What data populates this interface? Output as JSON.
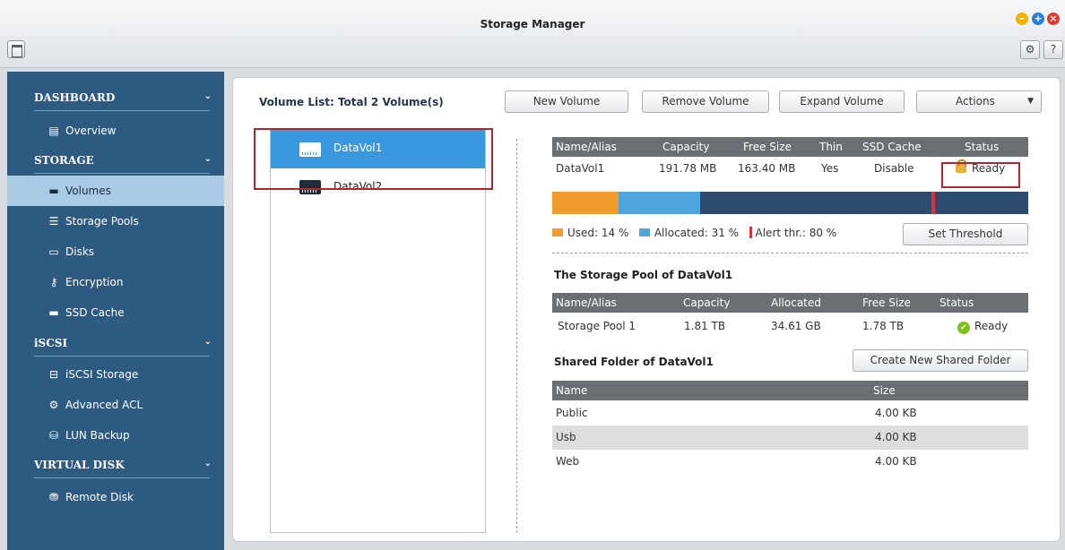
{
  "window": {
    "title": "Storage Manager"
  },
  "sidebar": {
    "sections": [
      {
        "label": "DASHBOARD",
        "items": [
          {
            "label": "Overview",
            "icon": "overview-icon"
          }
        ]
      },
      {
        "label": "STORAGE",
        "items": [
          {
            "label": "Volumes",
            "icon": "volume-icon",
            "active": true
          },
          {
            "label": "Storage Pools",
            "icon": "storage-pool-icon"
          },
          {
            "label": "Disks",
            "icon": "disk-icon"
          },
          {
            "label": "Encryption",
            "icon": "key-icon"
          },
          {
            "label": "SSD Cache",
            "icon": "ssd-icon"
          }
        ]
      },
      {
        "label": "iSCSI",
        "items": [
          {
            "label": "iSCSI Storage",
            "icon": "iscsi-icon"
          },
          {
            "label": "Advanced ACL",
            "icon": "gear-icon"
          },
          {
            "label": "LUN Backup",
            "icon": "backup-icon"
          }
        ]
      },
      {
        "label": "VIRTUAL DISK",
        "items": [
          {
            "label": "Remote Disk",
            "icon": "remote-disk-icon"
          }
        ]
      }
    ]
  },
  "main": {
    "volume_list_title": "Volume List: Total 2 Volume(s)",
    "toolbar": {
      "new_volume": "New Volume",
      "remove_volume": "Remove Volume",
      "expand_volume": "Expand Volume",
      "actions": "Actions"
    },
    "volumes": [
      {
        "name": "DataVol1",
        "selected": true
      },
      {
        "name": "DataVol2",
        "selected": false
      }
    ],
    "volume_table": {
      "headers": [
        "Name/Alias",
        "Capacity",
        "Free Size",
        "Thin",
        "SSD Cache",
        "Status"
      ],
      "row": {
        "name": "DataVol1",
        "capacity": "191.78 MB",
        "free_size": "163.40 MB",
        "thin": "Yes",
        "ssd_cache": "Disable",
        "status": "Ready"
      }
    },
    "usage": {
      "used_percent": 14,
      "allocated_percent": 31,
      "alert_percent": 80,
      "used_label": "Used: 14 %",
      "allocated_label": "Allocated: 31 %",
      "alert_label": "Alert thr.: 80 %",
      "colors": {
        "used": "#f19b2c",
        "allocated": "#4ea6dc",
        "free": "#2e4a6c",
        "alert": "#e0303a"
      }
    },
    "set_threshold": "Set Threshold",
    "pool_section_title": "The Storage Pool of DataVol1",
    "pool_table": {
      "headers": [
        "Name/Alias",
        "Capacity",
        "Allocated",
        "Free Size",
        "Status"
      ],
      "row": {
        "name": "Storage Pool 1",
        "capacity": "1.81 TB",
        "allocated": "34.61 GB",
        "free_size": "1.78 TB",
        "status": "Ready"
      }
    },
    "shared_section_title": "Shared Folder of DataVol1",
    "create_shared_folder": "Create New Shared Folder",
    "shared_table": {
      "headers": [
        "Name",
        "Size"
      ],
      "rows": [
        {
          "name": "Public",
          "size": "4.00 KB"
        },
        {
          "name": "Usb",
          "size": "4.00 KB"
        },
        {
          "name": "Web",
          "size": "4.00 KB"
        }
      ]
    }
  }
}
